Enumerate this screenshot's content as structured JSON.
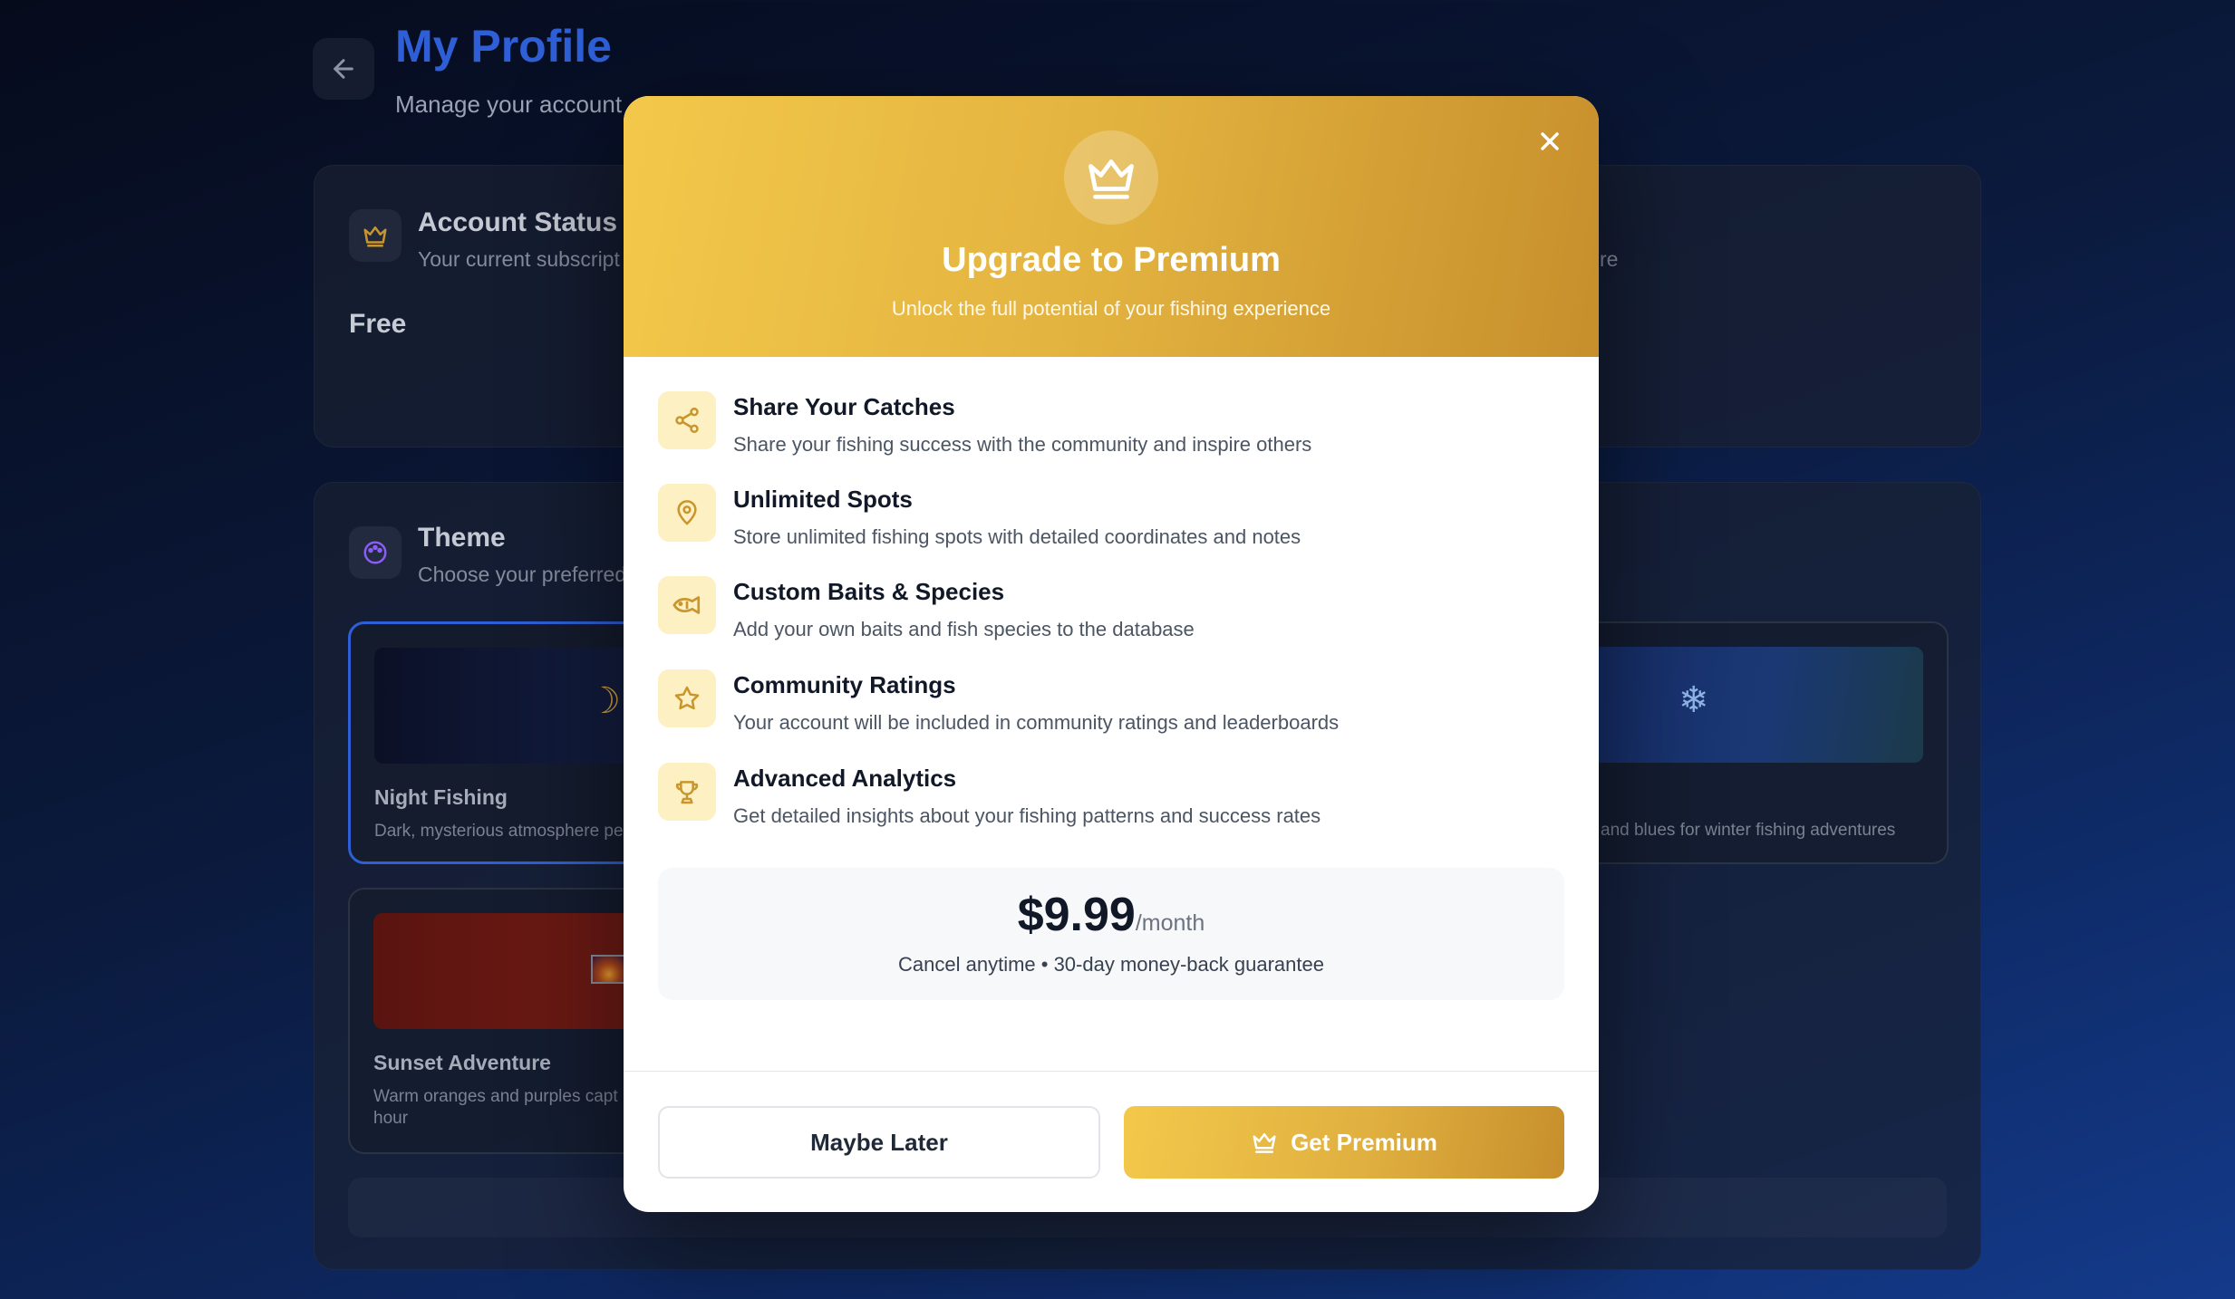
{
  "background": {
    "page_title": "My Profile",
    "page_subtitle": "Manage your account",
    "account_card": {
      "title": "Account Status",
      "subtitle": "Your current subscript",
      "plan": "Free"
    },
    "right_card_subtitle": "re",
    "theme_card": {
      "title": "Theme",
      "subtitle": "Choose your preferred"
    },
    "themes": [
      {
        "name": "Night Fishing",
        "desc": "Dark, mysterious atmosphere pe",
        "icon": "moon-icon",
        "selected": true
      },
      {
        "name": "",
        "desc": "and blues for winter fishing adventures",
        "icon": "snowflake-icon",
        "selected": false
      },
      {
        "name": "Sunset Adventure",
        "desc_line1": "Warm oranges and purples capt",
        "desc_line2": "hour",
        "icon": "sunset-icon",
        "selected": false
      }
    ]
  },
  "modal": {
    "title": "Upgrade to Premium",
    "subtitle": "Unlock the full potential of your fishing experience",
    "features": [
      {
        "icon": "share-icon",
        "title": "Share Your Catches",
        "desc": "Share your fishing success with the community and inspire others"
      },
      {
        "icon": "map-pin-icon",
        "title": "Unlimited Spots",
        "desc": "Store unlimited fishing spots with detailed coordinates and notes"
      },
      {
        "icon": "fish-icon",
        "title": "Custom Baits & Species",
        "desc": "Add your own baits and fish species to the database"
      },
      {
        "icon": "star-icon",
        "title": "Community Ratings",
        "desc": "Your account will be included in community ratings and leaderboards"
      },
      {
        "icon": "trophy-icon",
        "title": "Advanced Analytics",
        "desc": "Get detailed insights about your fishing patterns and success rates"
      }
    ],
    "price": {
      "amount": "$9.99",
      "period": "/month",
      "note": "Cancel anytime • 30-day money-back guarantee"
    },
    "buttons": {
      "later": "Maybe Later",
      "premium": "Get Premium"
    }
  },
  "colors": {
    "accent_gold": "#e2b23f",
    "accent_blue": "#2f5fd6",
    "icon_gold": "#c9962e",
    "feature_icon_bg": "#fdf0c2"
  }
}
